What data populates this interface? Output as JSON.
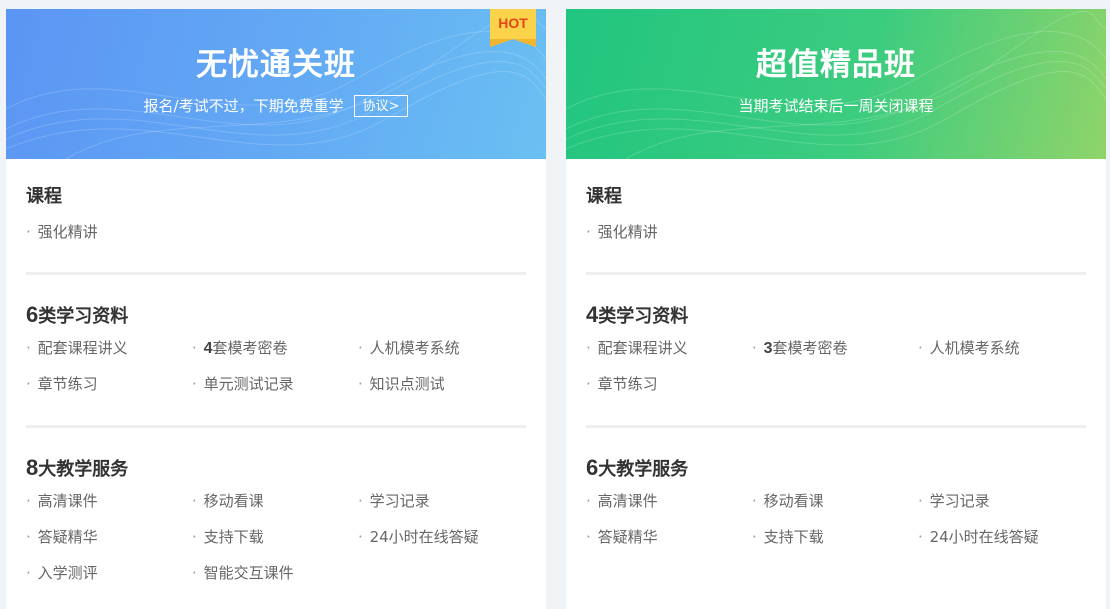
{
  "cards": [
    {
      "title": "无忧通关班",
      "subtitle": "报名/考试不过，下期免费重学",
      "agree_label": "协议>",
      "badge": "HOT",
      "accent": "#5b95f4",
      "course": {
        "title": "课程",
        "items": [
          "强化精讲"
        ]
      },
      "materials": {
        "count": "6",
        "title": "类学习资料",
        "items": [
          {
            "num": "",
            "text": "配套课程讲义"
          },
          {
            "num": "4",
            "text": "套模考密卷"
          },
          {
            "num": "",
            "text": "人机模考系统"
          },
          {
            "num": "",
            "text": "章节练习"
          },
          {
            "num": "",
            "text": "单元测试记录"
          },
          {
            "num": "",
            "text": "知识点测试"
          }
        ]
      },
      "services": {
        "count": "8",
        "title": "大教学服务",
        "items": [
          "高清课件",
          "移动看课",
          "学习记录",
          "答疑精华",
          "支持下载",
          "24小时在线答疑",
          "入学测评",
          "智能交互课件"
        ]
      }
    },
    {
      "title": "超值精品班",
      "subtitle": "当期考试结束后一周关闭课程",
      "accent": "#21c57f",
      "course": {
        "title": "课程",
        "items": [
          "强化精讲"
        ]
      },
      "materials": {
        "count": "4",
        "title": "类学习资料",
        "items": [
          {
            "num": "",
            "text": "配套课程讲义"
          },
          {
            "num": "3",
            "text": "套模考密卷"
          },
          {
            "num": "",
            "text": "人机模考系统"
          },
          {
            "num": "",
            "text": "章节练习"
          }
        ]
      },
      "services": {
        "count": "6",
        "title": "大教学服务",
        "items": [
          "高清课件",
          "移动看课",
          "学习记录",
          "答疑精华",
          "支持下载",
          "24小时在线答疑"
        ]
      }
    }
  ]
}
